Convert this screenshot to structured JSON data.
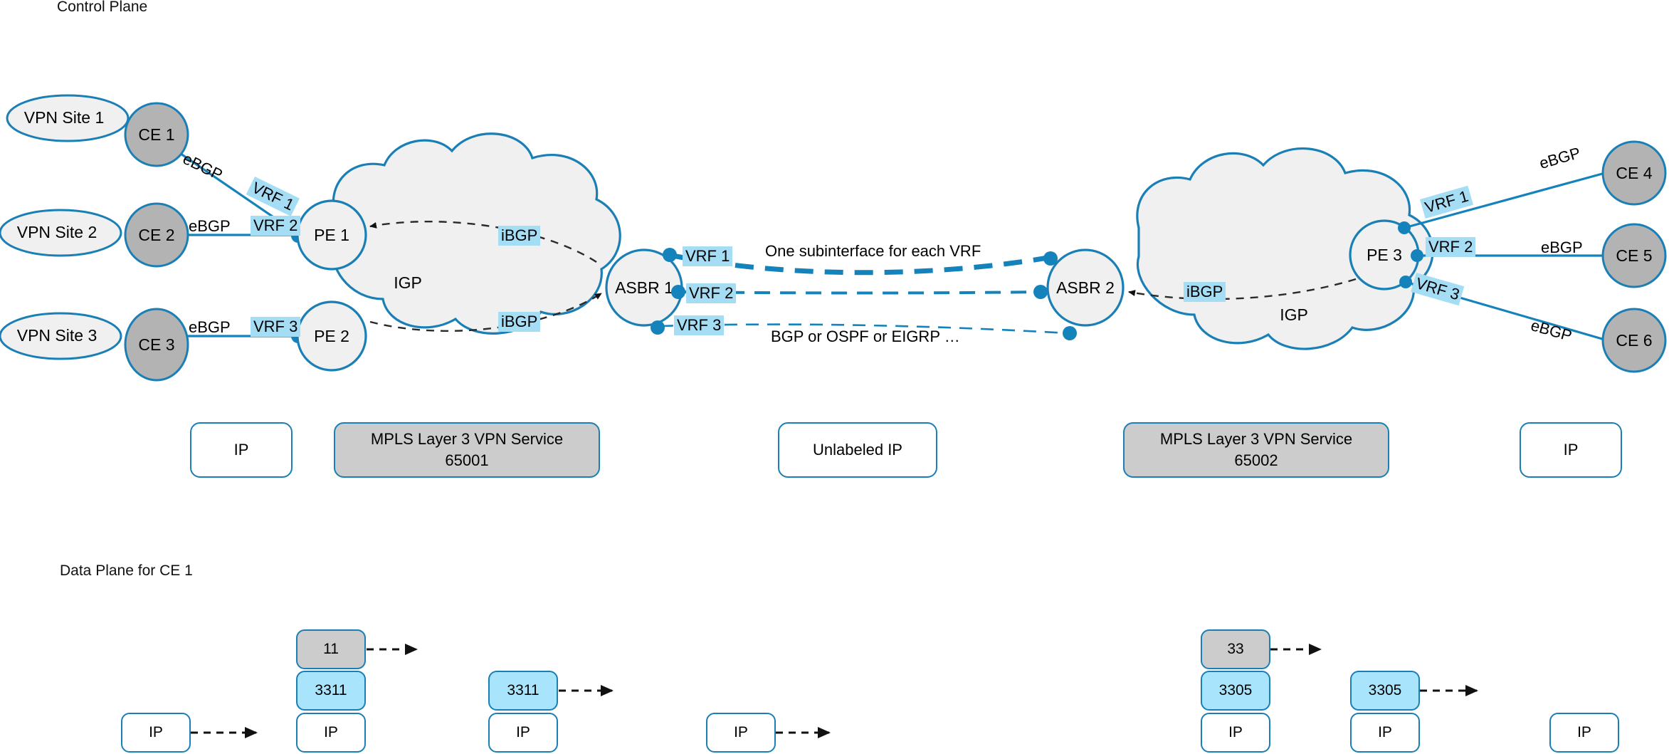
{
  "sections": {
    "control_plane": "Control Plane",
    "data_plane": "Data Plane for CE 1"
  },
  "control_plane": {
    "vpn_sites": [
      {
        "name": "VPN Site 1"
      },
      {
        "name": "VPN Site 2"
      },
      {
        "name": "VPN Site 3"
      }
    ],
    "ce_left": [
      {
        "name": "CE 1"
      },
      {
        "name": "CE 2"
      },
      {
        "name": "CE 3"
      }
    ],
    "ce_right": [
      {
        "name": "CE 4"
      },
      {
        "name": "CE 5"
      },
      {
        "name": "CE 6"
      }
    ],
    "pe_left": [
      {
        "name": "PE 1"
      },
      {
        "name": "PE 2"
      }
    ],
    "pe_right": [
      {
        "name": "PE 3"
      }
    ],
    "asbr": [
      {
        "name": "ASBR 1"
      },
      {
        "name": "ASBR 2"
      }
    ],
    "clouds": [
      {
        "name": "IGP"
      },
      {
        "name": "IGP"
      }
    ],
    "ebgp_label": "eBGP",
    "ibgp_label": "iBGP",
    "ebgp_links_left": [
      "eBGP",
      "eBGP",
      "eBGP"
    ],
    "ebgp_links_right": [
      "eBGP",
      "eBGP",
      "eBGP"
    ],
    "ibgp_links": [
      "iBGP",
      "iBGP",
      "iBGP"
    ],
    "vrf_left": [
      "VRF 1",
      "VRF 2",
      "VRF 3"
    ],
    "vrf_center": [
      "VRF 1",
      "VRF 2",
      "VRF 3"
    ],
    "vrf_right": [
      "VRF 1",
      "VRF 2",
      "VRF 3"
    ],
    "annotations": {
      "subinterface": "One subinterface for each VRF",
      "protocols": "BGP or OSPF or EIGRP …"
    }
  },
  "service_boxes": [
    {
      "id": "ip-left",
      "label": "IP",
      "style": "white"
    },
    {
      "id": "mpls-65001",
      "line1": "MPLS Layer 3 VPN Service",
      "line2": "65001",
      "style": "grey"
    },
    {
      "id": "unlabeled-ip",
      "label": "Unlabeled IP",
      "style": "white"
    },
    {
      "id": "mpls-65002",
      "line1": "MPLS Layer 3 VPN Service",
      "line2": "65002",
      "style": "grey"
    },
    {
      "id": "ip-right",
      "label": "IP",
      "style": "white"
    }
  ],
  "data_plane": {
    "stacks": [
      {
        "id": "stack-1",
        "layers": [
          {
            "value": "IP",
            "style": "white"
          }
        ]
      },
      {
        "id": "stack-2",
        "layers": [
          {
            "value": "11",
            "style": "grey"
          },
          {
            "value": "3311",
            "style": "cyan"
          },
          {
            "value": "IP",
            "style": "white"
          }
        ]
      },
      {
        "id": "stack-3",
        "layers": [
          {
            "value": "3311",
            "style": "cyan"
          },
          {
            "value": "IP",
            "style": "white"
          }
        ]
      },
      {
        "id": "stack-4",
        "layers": [
          {
            "value": "IP",
            "style": "white"
          }
        ]
      },
      {
        "id": "stack-5",
        "layers": [
          {
            "value": "33",
            "style": "grey"
          },
          {
            "value": "3305",
            "style": "cyan"
          },
          {
            "value": "IP",
            "style": "white"
          }
        ]
      },
      {
        "id": "stack-6",
        "layers": [
          {
            "value": "3305",
            "style": "cyan"
          },
          {
            "value": "IP",
            "style": "white"
          }
        ]
      },
      {
        "id": "stack-7",
        "layers": [
          {
            "value": "IP",
            "style": "white"
          }
        ]
      }
    ]
  },
  "colors": {
    "stroke_blue": "#1a7fb5",
    "link_blue": "#1583bb",
    "highlight_cyan": "#a5ddf5",
    "node_grey": "#b3b3b3",
    "cloud_grey": "#f0f0f0",
    "box_grey": "#cccccc",
    "packet_cyan": "#a8e4fb",
    "dash_black": "#1a1a1a"
  }
}
